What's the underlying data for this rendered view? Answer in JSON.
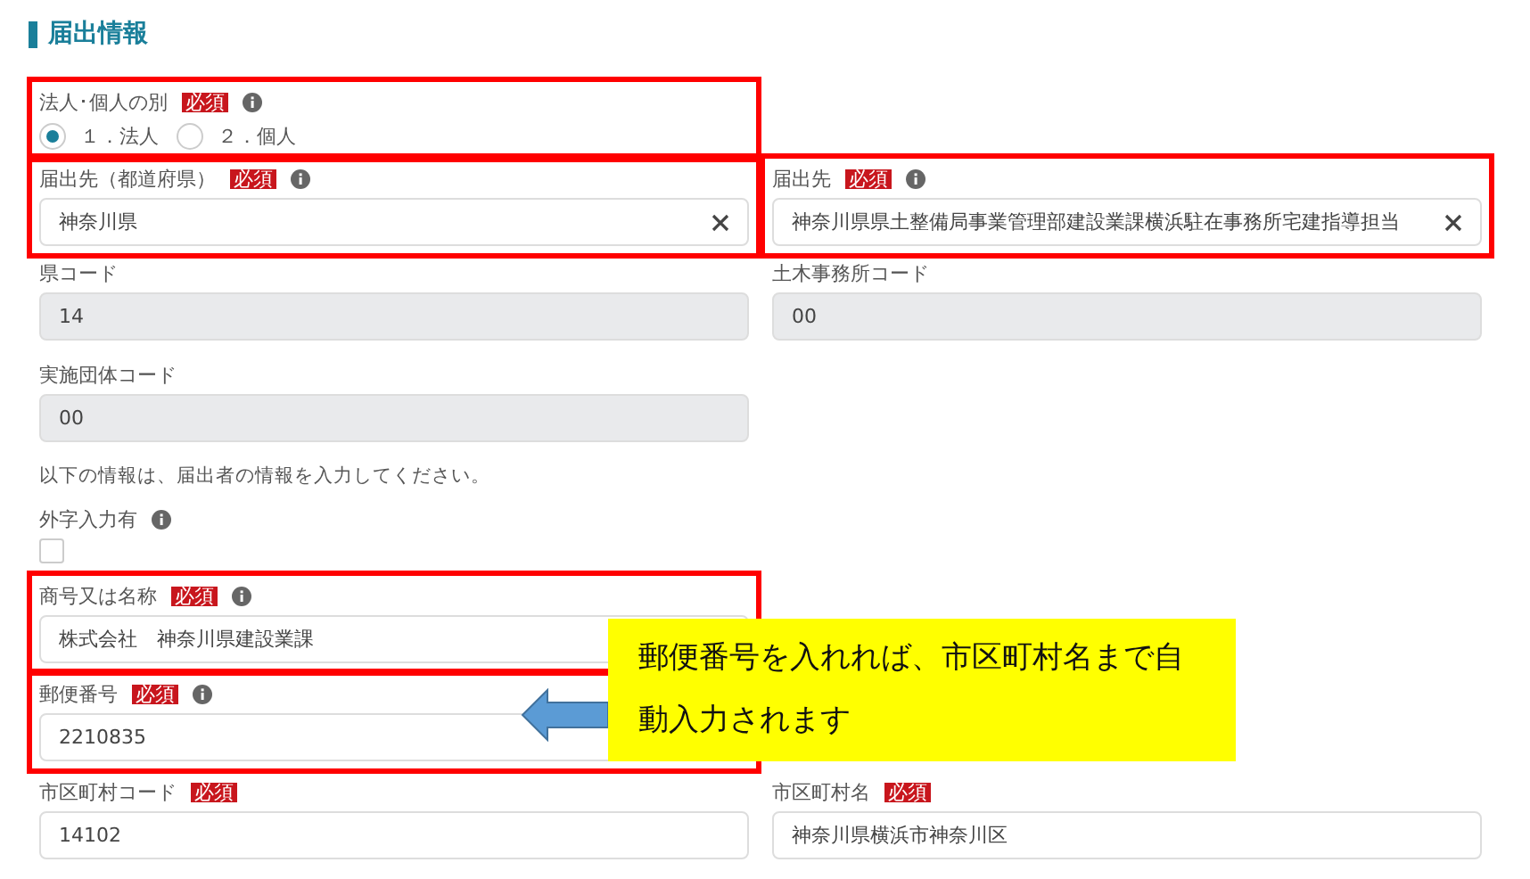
{
  "section_title": "届出情報",
  "rows": [
    {
      "fields": [
        {
          "kind": "radio",
          "label": "法人･個人の別",
          "badge": "必須",
          "info": true,
          "highlighted": true,
          "options": [
            {
              "label": "１．法人",
              "selected": true
            },
            {
              "label": "２．個人",
              "selected": false
            }
          ]
        }
      ]
    },
    {
      "fields": [
        {
          "kind": "select",
          "label": "届出先（都道府県）",
          "badge": "必須",
          "info": true,
          "highlighted": true,
          "value": "神奈川県",
          "clearable": true
        },
        {
          "kind": "select",
          "label": "届出先",
          "badge": "必須",
          "info": true,
          "highlighted": true,
          "value": "神奈川県県土整備局事業管理部建設業課横浜駐在事務所宅建指導担当",
          "clearable": true
        }
      ]
    },
    {
      "fields": [
        {
          "kind": "readonly",
          "label": "県コード",
          "value": "14"
        },
        {
          "kind": "readonly",
          "label": "土木事務所コード",
          "value": "00"
        }
      ]
    },
    {
      "fields": [
        {
          "kind": "readonly",
          "label": "実施団体コード",
          "value": "00"
        }
      ]
    },
    {
      "fields": [
        {
          "kind": "note",
          "text": "以下の情報は、届出者の情報を入力してください。"
        }
      ]
    },
    {
      "fields": [
        {
          "kind": "checkbox",
          "label": "外字入力有",
          "info": true,
          "checked": false
        }
      ]
    },
    {
      "fields": [
        {
          "kind": "text",
          "label": "商号又は名称",
          "badge": "必須",
          "info": true,
          "highlighted": true,
          "value": "株式会社　神奈川県建設業課"
        }
      ]
    },
    {
      "fields": [
        {
          "kind": "text",
          "label": "郵便番号",
          "badge": "必須",
          "info": true,
          "highlighted": true,
          "value": "2210835"
        }
      ],
      "callout": "郵便番号を入れれば、市区町村名まで自動入力されます"
    },
    {
      "fields": [
        {
          "kind": "text",
          "label": "市区町村コード",
          "badge": "必須",
          "value": "14102"
        },
        {
          "kind": "text",
          "label": "市区町村名",
          "badge": "必須",
          "value": "神奈川県横浜市神奈川区"
        }
      ]
    }
  ]
}
